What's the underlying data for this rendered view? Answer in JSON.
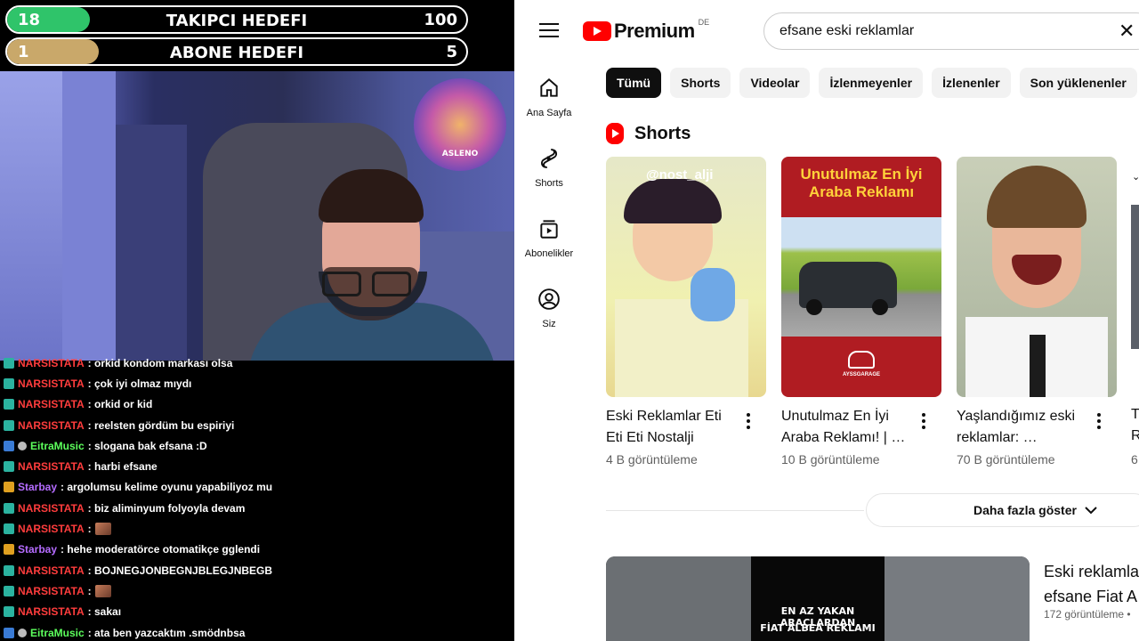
{
  "stream": {
    "goals": [
      {
        "label": "TAKIPCI HEDEFI",
        "current": "18",
        "target": "100",
        "progress": 0.18,
        "color": "#2fc46a"
      },
      {
        "label": "ABONE HEDEFI",
        "current": "1",
        "target": "5",
        "progress": 0.2,
        "color": "#c9a86a"
      }
    ],
    "chat": [
      {
        "user": "NARSISTATA",
        "color": "#ff3d3d",
        "text": ": orkid kondom markası olsa",
        "badge": "#2bb3a0",
        "emote": false
      },
      {
        "user": "NARSISTATA",
        "color": "#ff3d3d",
        "text": ": çok iyi olmaz mıydı",
        "badge": "#2bb3a0",
        "emote": false
      },
      {
        "user": "NARSISTATA",
        "color": "#ff3d3d",
        "text": ": orkid or kid",
        "badge": "#2bb3a0",
        "emote": false
      },
      {
        "user": "NARSISTATA",
        "color": "#ff3d3d",
        "text": ": reelsten gördüm bu espiriyi",
        "badge": "#2bb3a0",
        "emote": false
      },
      {
        "user": "EitraMusic",
        "color": "#5cff5c",
        "text": ": slogana bak efsana :D",
        "badge": "#3a7bd5",
        "emote": false
      },
      {
        "user": "NARSISTATA",
        "color": "#ff3d3d",
        "text": ": harbi efsane",
        "badge": "#2bb3a0",
        "emote": false
      },
      {
        "user": "Starbay",
        "color": "#b56cff",
        "text": ": argolumsu kelime oyunu yapabiliyoz mu",
        "badge": "#e0a020",
        "emote": false
      },
      {
        "user": "NARSISTATA",
        "color": "#ff3d3d",
        "text": ": biz aliminyum folyoyla devam",
        "badge": "#2bb3a0",
        "emote": false
      },
      {
        "user": "NARSISTATA",
        "color": "#ff3d3d",
        "text": ":",
        "badge": "#2bb3a0",
        "emote": true
      },
      {
        "user": "Starbay",
        "color": "#b56cff",
        "text": ": hehe moderatörce otomatikçe gglendi",
        "badge": "#e0a020",
        "emote": false
      },
      {
        "user": "NARSISTATA",
        "color": "#ff3d3d",
        "text": ": BOJNEGJONBEGNJBLEGJNBEGB",
        "badge": "#2bb3a0",
        "emote": false
      },
      {
        "user": "NARSISTATA",
        "color": "#ff3d3d",
        "text": ":",
        "badge": "#2bb3a0",
        "emote": true
      },
      {
        "user": "NARSISTATA",
        "color": "#ff3d3d",
        "text": ": sakaı",
        "badge": "#2bb3a0",
        "emote": false
      },
      {
        "user": "EitraMusic",
        "color": "#5cff5c",
        "text": ": ata ben yazcaktım .smödnbsa",
        "badge": "#3a7bd5",
        "emote": false
      }
    ],
    "logo_text": "ASLENO"
  },
  "yt": {
    "brand": "Premium",
    "country": "DE",
    "search_value": "efsane eski reklamlar",
    "sidebar": [
      {
        "label": "Ana Sayfa",
        "icon": "home-icon"
      },
      {
        "label": "Shorts",
        "icon": "shorts-icon"
      },
      {
        "label": "Abonelikler",
        "icon": "subscriptions-icon"
      },
      {
        "label": "Siz",
        "icon": "account-icon"
      }
    ],
    "chips": [
      "Tümü",
      "Shorts",
      "Videolar",
      "İzlenmeyenler",
      "İzlenenler",
      "Son yüklenenler"
    ],
    "shorts_heading": "Shorts",
    "shorts": [
      {
        "title": "Eski Reklamlar Eti Eti Eti Nostalji",
        "views": "4 B görüntüleme",
        "overlay": "@nost_alji"
      },
      {
        "title": "Unutulmaz En İyi Araba Reklamı! | …",
        "views": "10 B görüntüleme",
        "overlay": "Unutulmaz En İyi Araba Reklamı",
        "brand": "AYSSGARAGE"
      },
      {
        "title": "Yaşlandığımız eski reklamlar: …",
        "views": "70 B görüntüleme",
        "overlay": ""
      }
    ],
    "partial_card": {
      "title_a": "T",
      "title_b": "R",
      "views": "6"
    },
    "more_label": "Daha fazla göster",
    "video": {
      "title_line1": "Eski reklamla",
      "title_line2": "efsane Fiat A",
      "views": "172 görüntüleme •",
      "thumb_line1": "EN AZ YAKAN ARAÇLARDAN",
      "thumb_line2": "FİAT ALBEA REKLAMI"
    }
  }
}
